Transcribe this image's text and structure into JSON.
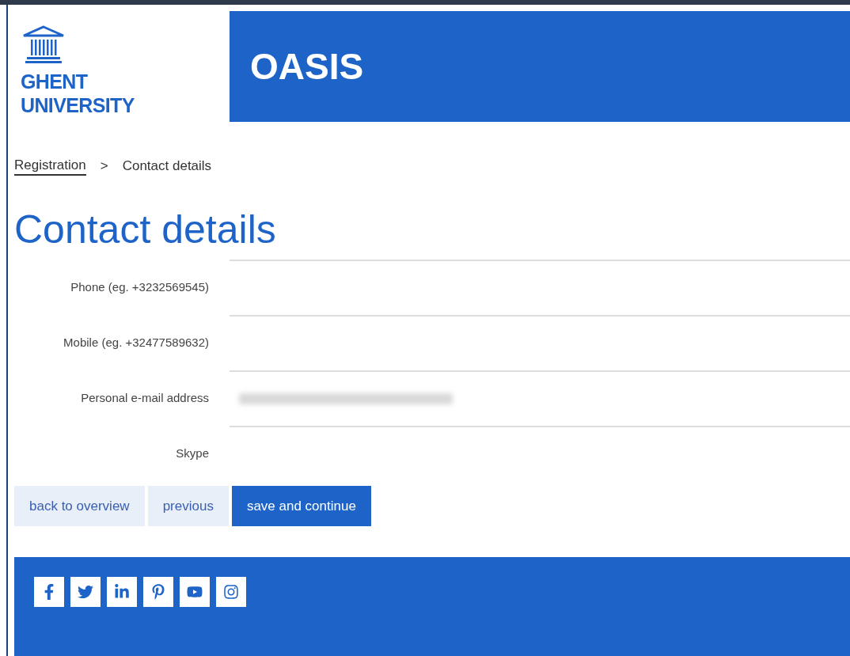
{
  "header": {
    "logo_lines": [
      "GHENT",
      "UNIVERSITY"
    ],
    "app_title": "OASIS"
  },
  "breadcrumb": [
    {
      "label": "Registration",
      "link": true
    },
    {
      "label": ">",
      "link": false
    },
    {
      "label": "Contact details",
      "link": false
    }
  ],
  "page_title": "Contact details",
  "fields": [
    {
      "label": "Phone (eg. +3232569545)",
      "redacted": false
    },
    {
      "label": "Mobile (eg. +32477589632)",
      "redacted": false
    },
    {
      "label": "Personal e-mail address",
      "redacted": true
    },
    {
      "label": "Skype",
      "redacted": false
    }
  ],
  "buttons": [
    {
      "label": "back to overview",
      "kind": "secondary"
    },
    {
      "label": "previous",
      "kind": "secondary"
    },
    {
      "label": "save and continue",
      "kind": "primary"
    }
  ],
  "footer": {
    "social": [
      {
        "kind": "facebook"
      },
      {
        "kind": "twitter"
      },
      {
        "kind": "linkedin"
      },
      {
        "kind": "pinterest"
      },
      {
        "kind": "youtube"
      },
      {
        "kind": "instagram"
      }
    ]
  }
}
